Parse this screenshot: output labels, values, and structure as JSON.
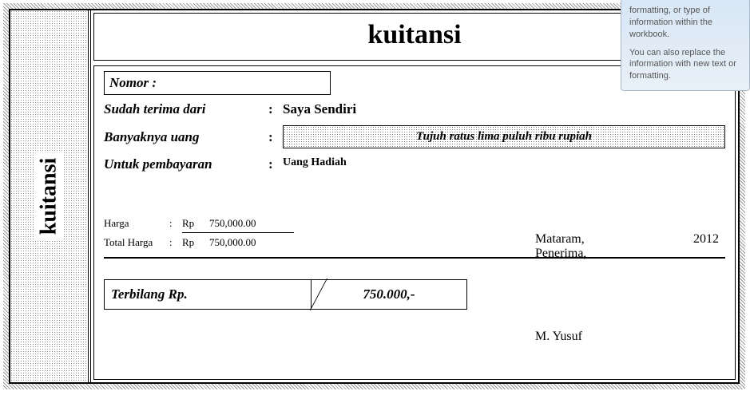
{
  "tooltip": {
    "line1": "formatting, or type of information within the workbook.",
    "line2": "You can also replace the information with new text or formatting."
  },
  "stub": {
    "title": "kuitansi"
  },
  "header": {
    "title": "kuitansi"
  },
  "fields": {
    "nomor_label": "Nomor :",
    "sudah_label": "Sudah terima dari",
    "sudah_value": "Saya Sendiri",
    "banyak_label": "Banyaknya uang",
    "banyak_value": "Tujuh ratus lima puluh  ribu rupiah",
    "untuk_label": "Untuk pembayaran",
    "untuk_value": "Uang Hadiah",
    "colon": ":"
  },
  "prices": {
    "harga_label": "Harga",
    "total_label": "Total Harga",
    "colon": ":",
    "currency": "Rp",
    "harga_value": "750,000.00",
    "total_value": "750,000.00"
  },
  "signature": {
    "place": "Mataram,",
    "year": "2012",
    "role": "Penerima,",
    "name": "M. Yusuf"
  },
  "terbilang": {
    "label": "Terbilang  Rp.",
    "value": "750.000,-"
  }
}
